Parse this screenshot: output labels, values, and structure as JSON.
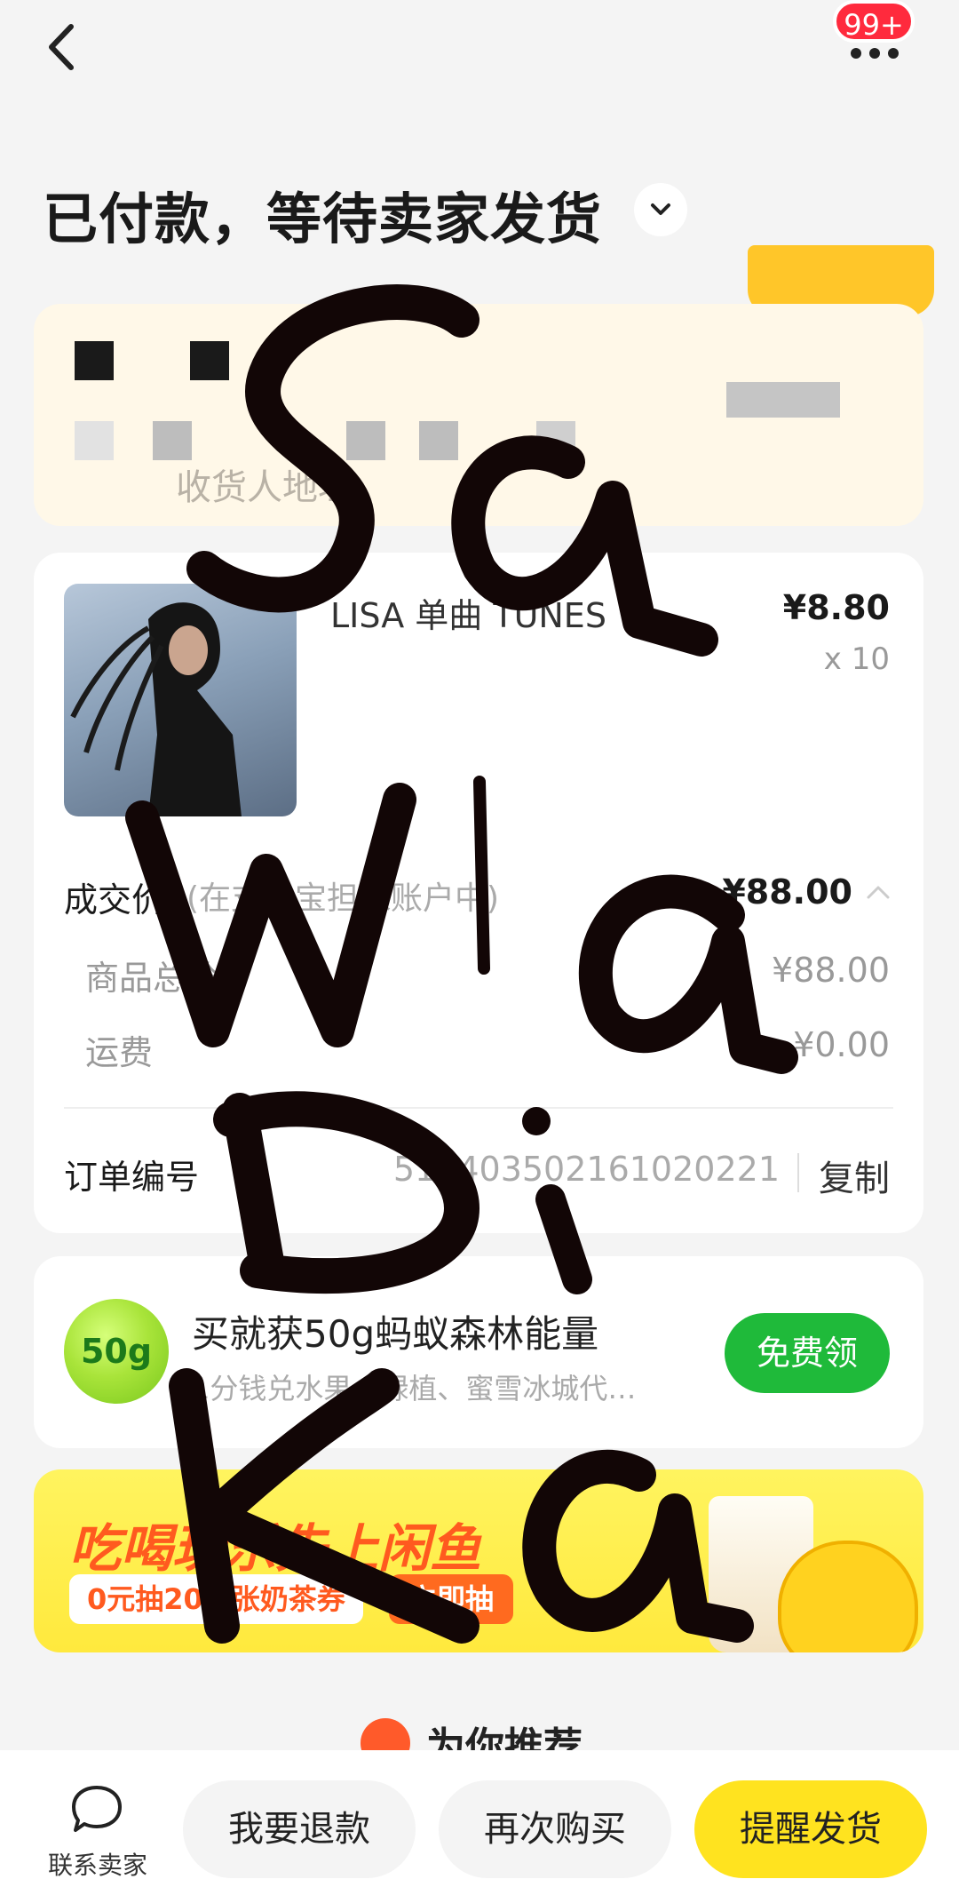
{
  "header": {
    "badge": "99+",
    "status_title": "已付款，等待卖家发货"
  },
  "address": {
    "line": "收货人地址"
  },
  "order": {
    "product_title": "LISA 单曲 TUNES",
    "price": "¥8.80",
    "quantity": "x 10",
    "deal_label": "成交价",
    "deal_note": "(在支付宝担保账户中)",
    "deal_value": "¥88.00",
    "goods_label": "商品总价",
    "goods_value": "¥88.00",
    "shipping_label": "运费",
    "shipping_value": "¥0.00",
    "order_no_label": "订单编号",
    "order_no_value": "5114035021610202​21",
    "copy_label": "复制"
  },
  "energy": {
    "ball_label": "50g",
    "title": "买就获50g蚂蚁森林能量",
    "subtitle": "1分钱兑水果、绿植、蜜雪冰城代…",
    "button": "免费领"
  },
  "banner": {
    "title": "吃喝玩乐先上闲鱼",
    "subtitle": "0元抽20万张奶茶券",
    "cta": "立即抽"
  },
  "recommend": {
    "title": "为你推荐"
  },
  "bottom": {
    "contact_label": "联系卖家",
    "refund": "我要退款",
    "rebuy": "再次购买",
    "remind": "提醒发货"
  },
  "watermark": {
    "text": "Sa Wa Di Ka"
  },
  "colors": {
    "primary_yellow": "#ffe31f",
    "energy_green": "#1fba3a",
    "badge_red": "#ff2a3d"
  }
}
